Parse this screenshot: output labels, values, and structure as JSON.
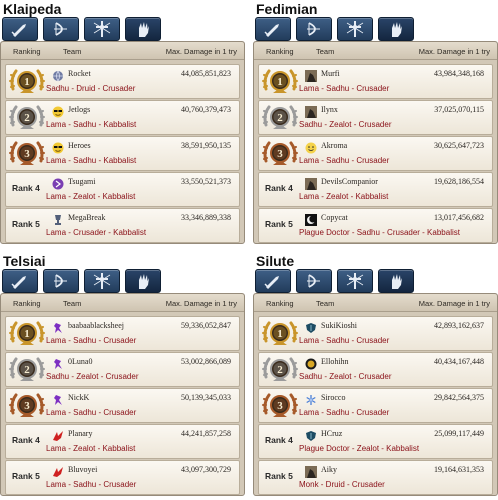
{
  "header": {
    "ranking": "Ranking",
    "team": "Team",
    "max_damage": "Max. Damage in 1 try"
  },
  "tab_icons": [
    "sword-icon",
    "bow-icon",
    "cross-staff-icon",
    "hand-icon"
  ],
  "rank_labels": [
    "Rank 4",
    "Rank 5"
  ],
  "colors": {
    "gold": "#c9952b",
    "silver": "#9b9b9b",
    "bronze": "#a65a2a",
    "class_text": "#8a1018",
    "tab_blue": "#2e4a6e"
  },
  "servers": [
    {
      "name": "Klaipeda",
      "rows": [
        {
          "name": "Rocket",
          "damage": "44,085,851,823",
          "classes": "Sadhu - Druid - Crusader",
          "avatar": "globe-icon"
        },
        {
          "name": "Jetlogs",
          "damage": "40,760,379,473",
          "classes": "Lama - Sadhu - Kabbalist",
          "avatar": "sunglasses-face-icon"
        },
        {
          "name": "Heroes",
          "damage": "38,591,950,135",
          "classes": "Lama - Sadhu - Kabbalist",
          "avatar": "sunglasses-face-icon"
        },
        {
          "name": "Tsugami",
          "damage": "33,550,521,373",
          "classes": "Lama - Zealot - Kabbalist",
          "avatar": "purple-emblem-icon"
        },
        {
          "name": "MegaBreak",
          "damage": "33,346,889,338",
          "classes": "Lama - Crusader - Kabbalist",
          "avatar": "trophy-icon"
        }
      ]
    },
    {
      "name": "Fedimian",
      "rows": [
        {
          "name": "Murfi",
          "damage": "43,984,348,168",
          "classes": "Lama - Sadhu - Crusader",
          "avatar": "portrait-icon"
        },
        {
          "name": "Ilynx",
          "damage": "37,025,070,115",
          "classes": "Sadhu - Zealot - Crusader",
          "avatar": "portrait-icon"
        },
        {
          "name": "Akroma",
          "damage": "30,625,647,723",
          "classes": "Lama - Sadhu - Crusader",
          "avatar": "smiley-icon"
        },
        {
          "name": "DevilsCompanior",
          "damage": "19,628,186,554",
          "classes": "Lama - Zealot - Kabbalist",
          "avatar": "portrait-icon"
        },
        {
          "name": "Copycat",
          "damage": "13,017,456,682",
          "classes": "Plague Doctor - Sadhu - Crusader - Kabbalist",
          "avatar": "moon-icon"
        }
      ]
    },
    {
      "name": "Telsiai",
      "rows": [
        {
          "name": "baabaablacksheej",
          "damage": "59,336,052,847",
          "classes": "Lama - Sadhu - Crusader",
          "avatar": "purple-figure-icon"
        },
        {
          "name": "0Luna0",
          "damage": "53,002,866,089",
          "classes": "Sadhu - Zealot - Crusader",
          "avatar": "purple-figure-icon"
        },
        {
          "name": "NickK",
          "damage": "50,139,345,033",
          "classes": "Lama - Sadhu - Crusader",
          "avatar": "purple-figure-icon"
        },
        {
          "name": "Planary",
          "damage": "44,241,857,258",
          "classes": "Lama - Zealot - Kabbalist",
          "avatar": "red-wing-icon"
        },
        {
          "name": "Bluvoyei",
          "damage": "43,097,300,729",
          "classes": "Lama - Sadhu - Crusader",
          "avatar": "red-wing-icon"
        }
      ]
    },
    {
      "name": "Silute",
      "rows": [
        {
          "name": "SukiKioshi",
          "damage": "42,893,162,637",
          "classes": "Lama - Sadhu - Crusader",
          "avatar": "shield-icon"
        },
        {
          "name": "Ellohihn",
          "damage": "40,434,167,448",
          "classes": "Sadhu - Zealot - Crusader",
          "avatar": "gold-emblem-icon"
        },
        {
          "name": "Sirocco",
          "damage": "29,842,564,375",
          "classes": "Lama - Sadhu - Crusader",
          "avatar": "snowflake-icon"
        },
        {
          "name": "HCruz",
          "damage": "25,099,117,449",
          "classes": "Plague Doctor - Zealot - Kabbalist",
          "avatar": "shield-icon"
        },
        {
          "name": "Aiky",
          "damage": "19,164,631,353",
          "classes": "Monk - Druid - Crusader",
          "avatar": "portrait-icon"
        }
      ]
    }
  ]
}
